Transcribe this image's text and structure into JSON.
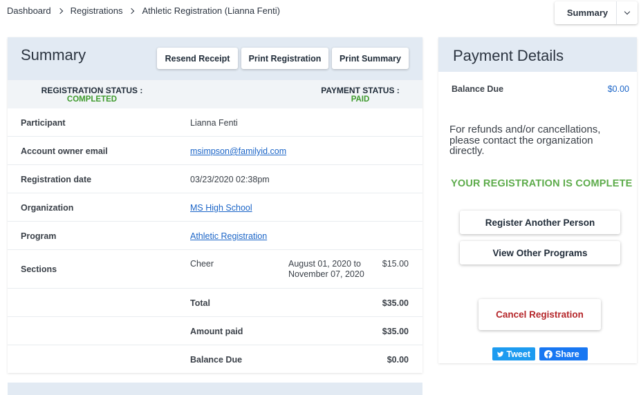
{
  "breadcrumb": {
    "items": [
      "Dashboard",
      "Registrations",
      "Athletic Registration (Lianna Fenti)"
    ]
  },
  "top_dropdown": {
    "label": "Summary"
  },
  "summary": {
    "title": "Summary",
    "buttons": {
      "resend_receipt": "Resend Receipt",
      "print_registration": "Print Registration",
      "print_summary": "Print Summary"
    },
    "registration_status_label": "REGISTRATION STATUS :",
    "registration_status_value": "COMPLETED",
    "payment_status_label": "PAYMENT STATUS :",
    "payment_status_value": "PAID",
    "rows": {
      "participant": {
        "label": "Participant",
        "value": "Lianna Fenti"
      },
      "email": {
        "label": "Account owner email",
        "value": "msimpson@familyid.com"
      },
      "date": {
        "label": "Registration date",
        "value": "03/23/2020 02:38pm"
      },
      "organization": {
        "label": "Organization",
        "value": "MS High School"
      },
      "program": {
        "label": "Program",
        "value": "Athletic Registration"
      },
      "sections": {
        "label": "Sections",
        "name": "Cheer",
        "date_line1": "August 01, 2020 to",
        "date_line2": "November 07, 2020",
        "price": "$15.00"
      },
      "total": {
        "label": "Total",
        "value": "$35.00"
      },
      "amount_paid": {
        "label": "Amount paid",
        "value": "$35.00"
      },
      "balance_due": {
        "label": "Balance Due",
        "value": "$0.00"
      }
    }
  },
  "payment_details": {
    "title": "Payment Details",
    "balance_label": "Balance Due",
    "balance_value": "$0.00",
    "refund_text": "For refunds and/or cancellations, please contact the organization directly.",
    "complete_text": "YOUR REGISTRATION IS COMPLETE",
    "register_another": "Register Another Person",
    "view_other": "View Other Programs",
    "cancel": "Cancel Registration",
    "tweet": "Tweet",
    "share": "Share"
  },
  "colors": {
    "accent_blue": "#1a64c7",
    "status_green": "#3e9a2d",
    "cancel_red": "#b5262a",
    "header_bg": "#e2eaf3"
  }
}
